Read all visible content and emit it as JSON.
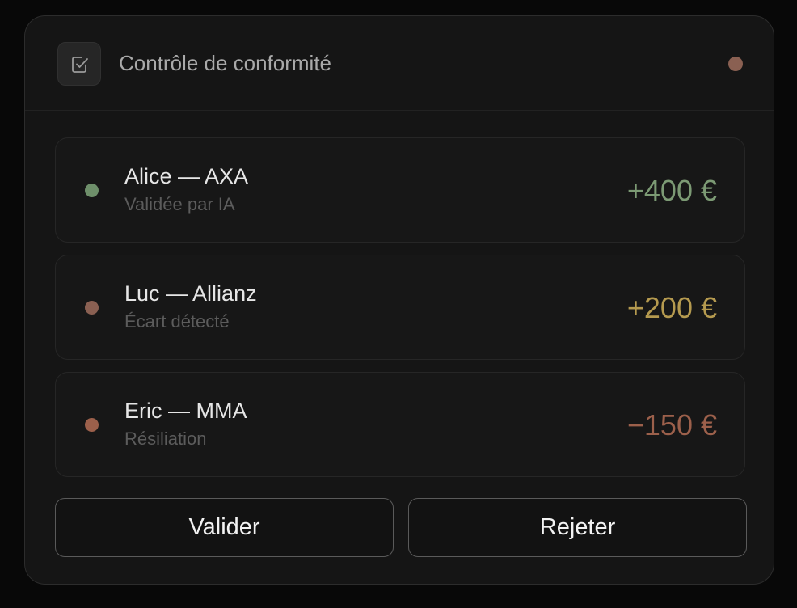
{
  "header": {
    "title": "Contrôle de conformité",
    "icon": "checkbox-check-icon",
    "status_color": "#8a6052"
  },
  "rows": [
    {
      "name": "Alice — AXA",
      "status": "Validée par IA",
      "amount": "+400 €",
      "dot_color": "#6e8f6a",
      "amount_color": "#7c9a74"
    },
    {
      "name": "Luc — Allianz",
      "status": "Écart détecté",
      "amount": "+200 €",
      "dot_color": "#8a6052",
      "amount_color": "#b59a4f"
    },
    {
      "name": "Eric — MMA",
      "status": "Résiliation",
      "amount": "−150 €",
      "dot_color": "#9c604b",
      "amount_color": "#9c604b"
    }
  ],
  "actions": {
    "validate_label": "Valider",
    "reject_label": "Rejeter"
  }
}
